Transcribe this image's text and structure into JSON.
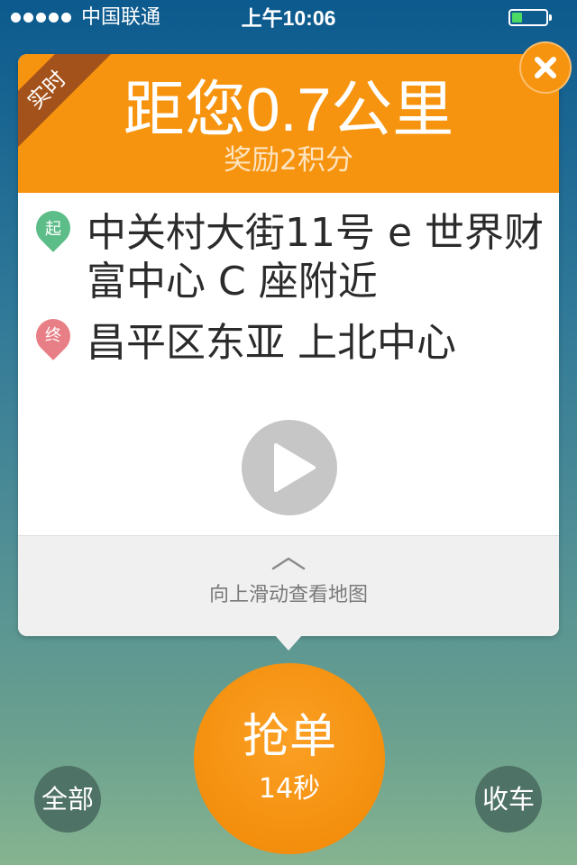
{
  "status_bar": {
    "carrier": "中国联通",
    "time": "上午10:06"
  },
  "order_card": {
    "badge": "实时",
    "distance": "距您0.7公里",
    "reward": "奖励2积分",
    "start": {
      "pin_label": "起",
      "address": "中关村大街11号 e 世界财富中心 C 座附近"
    },
    "end": {
      "pin_label": "终",
      "address": "昌平区东亚 上北中心"
    },
    "swipe_hint": "向上滑动查看地图"
  },
  "actions": {
    "grab_label": "抢单",
    "grab_timer": "14秒",
    "all_label": "全部",
    "stop_label": "收车"
  },
  "icons": {
    "close": "close-icon",
    "play": "play-icon",
    "chevron": "chevron-up-icon"
  },
  "colors": {
    "accent_orange": "#f7940f",
    "ribbon_brown": "#a4521c",
    "start_pin": "#5cbd88",
    "end_pin": "#e87f86",
    "side_button": "#4e7266",
    "battery_fill": "#4cd964"
  }
}
